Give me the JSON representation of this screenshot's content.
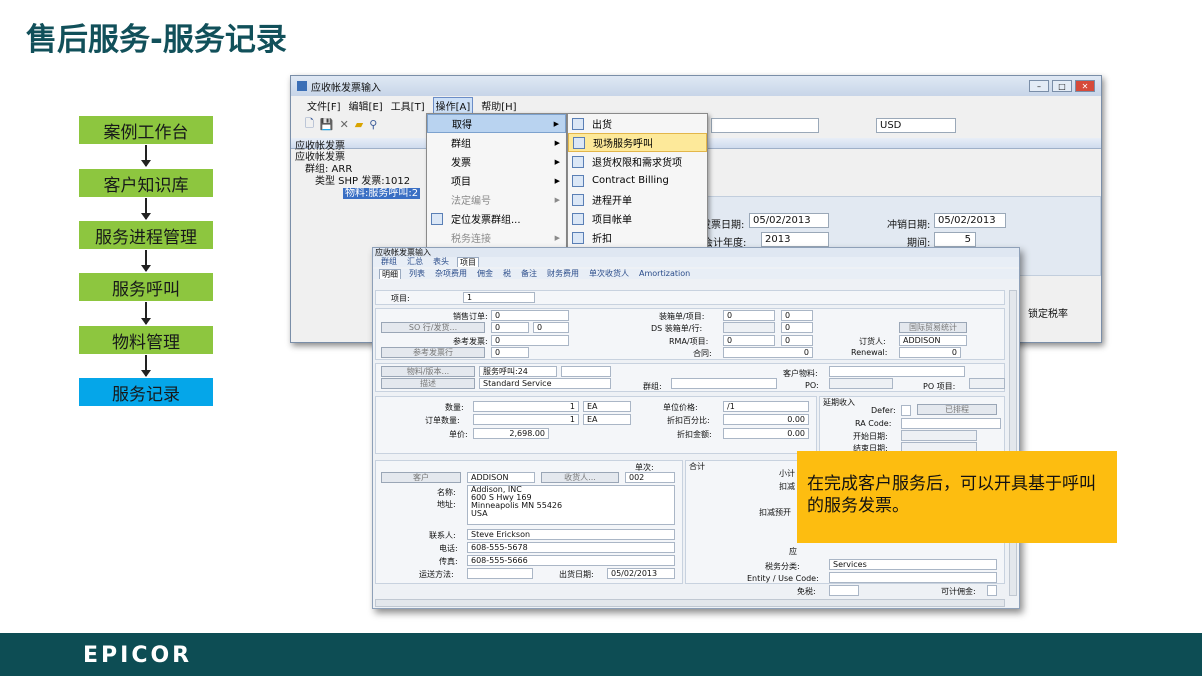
{
  "slide": {
    "title": "售后服务-服务记录",
    "logo": "EPICOR"
  },
  "flow": [
    "案例工作台",
    "客户知识库",
    "服务进程管理",
    "服务呼叫",
    "物料管理",
    "服务记录"
  ],
  "callout": "在完成客户服务后，可以开具基于呼叫的服务发票。",
  "main_window": {
    "title": "应收帐发票输入",
    "menus": [
      "文件[F]",
      "编辑[E]",
      "工具[T]",
      "操作[A]",
      "帮助[H]"
    ],
    "tree_header": "应收帐发票",
    "tree": [
      "应收帐发票",
      "群组: ARR",
      "类型 SHP 发票:1012",
      "物料:服务呼叫:2"
    ],
    "currency": "USD",
    "invoice_date_label": "发票日期:",
    "invoice_date": "05/02/2013",
    "reverse_date_label": "冲销日期:",
    "reverse_date": "05/02/2013",
    "fiscal_year_label": "会计年度:",
    "fiscal_year": "2013",
    "period_label": "期间:",
    "period": "5",
    "lock_tax_label": "锁定税率"
  },
  "menu_ops": [
    {
      "label": "取得",
      "sub": true,
      "state": "highlight"
    },
    {
      "label": "群组",
      "sub": true,
      "state": ""
    },
    {
      "label": "发票",
      "sub": true,
      "state": ""
    },
    {
      "label": "项目",
      "sub": true,
      "state": ""
    },
    {
      "label": "法定编号",
      "sub": true,
      "state": "disabled"
    },
    {
      "label": "定位发票群组...",
      "sub": false,
      "state": ""
    },
    {
      "label": "税务连接",
      "sub": true,
      "state": "disabled"
    }
  ],
  "menu_get": [
    {
      "label": "出货",
      "state": ""
    },
    {
      "label": "现场服务呼叫",
      "state": "highlight"
    },
    {
      "label": "退货权限和需求货项",
      "state": ""
    },
    {
      "label": "Contract Billing",
      "state": ""
    },
    {
      "label": "进程开单",
      "state": ""
    },
    {
      "label": "项目帐单",
      "state": ""
    },
    {
      "label": "折扣",
      "state": ""
    }
  ],
  "detail_window": {
    "title": "应收帐发票输入",
    "tabs_top": [
      "群组",
      "汇总",
      "表头",
      "项目"
    ],
    "tabs_sub": [
      "明细",
      "列表",
      "杂项费用",
      "佣金",
      "税",
      "备注",
      "财务费用",
      "单次收货人",
      "Amortization"
    ],
    "item_label": "项目:",
    "item_value": "1",
    "sales_order_label": "销售订单:",
    "sales_order": "0",
    "so_line_btn": "SO 行/发货...",
    "so_line": "0",
    "so_rel": "0",
    "ref_invoice_label": "参考发票:",
    "ref_invoice": "0",
    "ref_invoice_line_btn": "参考发票行",
    "ref_invoice_line": "0",
    "pack_label": "装箱单/项目:",
    "pack": "0",
    "pack2": "0",
    "ds_pack_label": "DS 装箱单/行:",
    "ds_pack2": "0",
    "rma_label": "RMA/项目:",
    "rma": "0",
    "rma2": "0",
    "contract_label": "合同:",
    "contract": "0",
    "intl_btn": "国际贸易统计",
    "ordered_by_label": "订货人:",
    "ordered_by": "ADDISON",
    "renewal_label": "Renewal:",
    "renewal": "0",
    "part_btn": "物料/版本...",
    "part": "服务呼叫:24",
    "desc_btn": "描述",
    "desc": "Standard Service",
    "group_label": "群组:",
    "cust_part_label": "客户物料:",
    "po_label": "PO:",
    "po_item_label": "PO 项目:",
    "qty_label": "数量:",
    "qty": "1",
    "qty_uom": "EA",
    "order_qty_label": "订单数量:",
    "order_qty": "1",
    "order_uom": "EA",
    "unit_price_label": "单价:",
    "unit_price": "2,698.00",
    "price_per_label": "单位价格:",
    "price_per": "/1",
    "disc_pct_label": "折扣百分比:",
    "disc_pct": "0.00",
    "disc_amt_label": "折扣金额:",
    "disc_amt": "0.00",
    "deferred_title": "延期收入",
    "defer_label": "Defer:",
    "scheduled_btn": "已排程",
    "ra_code_label": "RA Code:",
    "start_date_label": "开始日期:",
    "end_date_label": "结束日期:",
    "customer_btn": "客户",
    "customer": "ADDISON",
    "shipto_btn": "收货人...",
    "single_label": "单次:",
    "shipto": "002",
    "name_label": "名称:",
    "address_label": "地址:",
    "address": [
      "Addison, INC",
      "600 S Hwy 169",
      "Minneapolis MN 55426",
      "USA"
    ],
    "contact_label": "联系人:",
    "contact": "Steve Erickson",
    "phone_label": "电话:",
    "phone": "608-555-5678",
    "fax_label": "传真:",
    "fax": "608-555-5666",
    "ship_via_label": "运送方法:",
    "ship_date_label": "出货日期:",
    "ship_date": "05/02/2013",
    "totals_title": "合计",
    "subtotal_label": "小计",
    "discount_label": "扣减",
    "withholding_label": "扣减预开",
    "due_label": "应",
    "tax_cat_label": "税务分类:",
    "tax_cat": "Services",
    "entity_label": "Entity / Use Code:",
    "exempt_label": "免税:",
    "commissionable_label": "可计佣金:"
  }
}
